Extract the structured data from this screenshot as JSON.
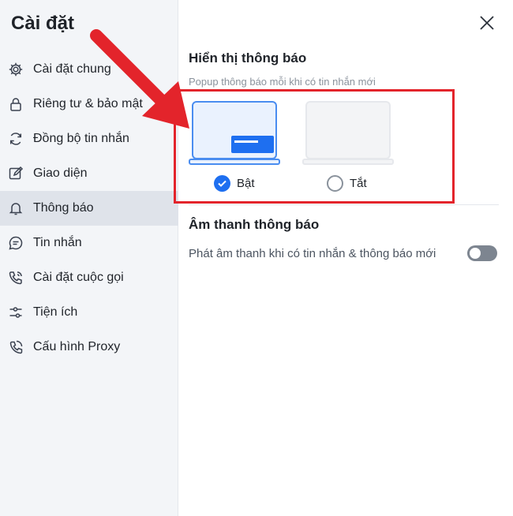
{
  "sidebar": {
    "title": "Cài đặt",
    "items": [
      {
        "label": "Cài đặt chung",
        "icon": "gear-icon"
      },
      {
        "label": "Riêng tư & bảo mật",
        "icon": "lock-icon"
      },
      {
        "label": "Đồng bộ tin nhắn",
        "icon": "sync-icon"
      },
      {
        "label": "Giao diện",
        "icon": "edit-icon"
      },
      {
        "label": "Thông báo",
        "icon": "bell-icon",
        "active": true
      },
      {
        "label": "Tin nhắn",
        "icon": "chat-icon"
      },
      {
        "label": "Cài đặt cuộc gọi",
        "icon": "phone-icon"
      },
      {
        "label": "Tiện ích",
        "icon": "sliders-icon"
      },
      {
        "label": "Cấu hình Proxy",
        "icon": "proxy-icon"
      }
    ]
  },
  "main": {
    "display_section": {
      "title": "Hiển thị thông báo",
      "description": "Popup thông báo mỗi khi có tin nhắn mới",
      "options": [
        {
          "label": "Bật",
          "selected": true
        },
        {
          "label": "Tắt",
          "selected": false
        }
      ]
    },
    "sound_section": {
      "title": "Âm thanh thông báo",
      "description": "Phát âm thanh khi có tin nhắn & thông báo mới",
      "toggle_on": false
    }
  },
  "colors": {
    "accent": "#1e6ff0",
    "highlight": "#e3242b",
    "sidebar_bg": "#f3f5f8",
    "active_bg": "#dfe3ea"
  }
}
